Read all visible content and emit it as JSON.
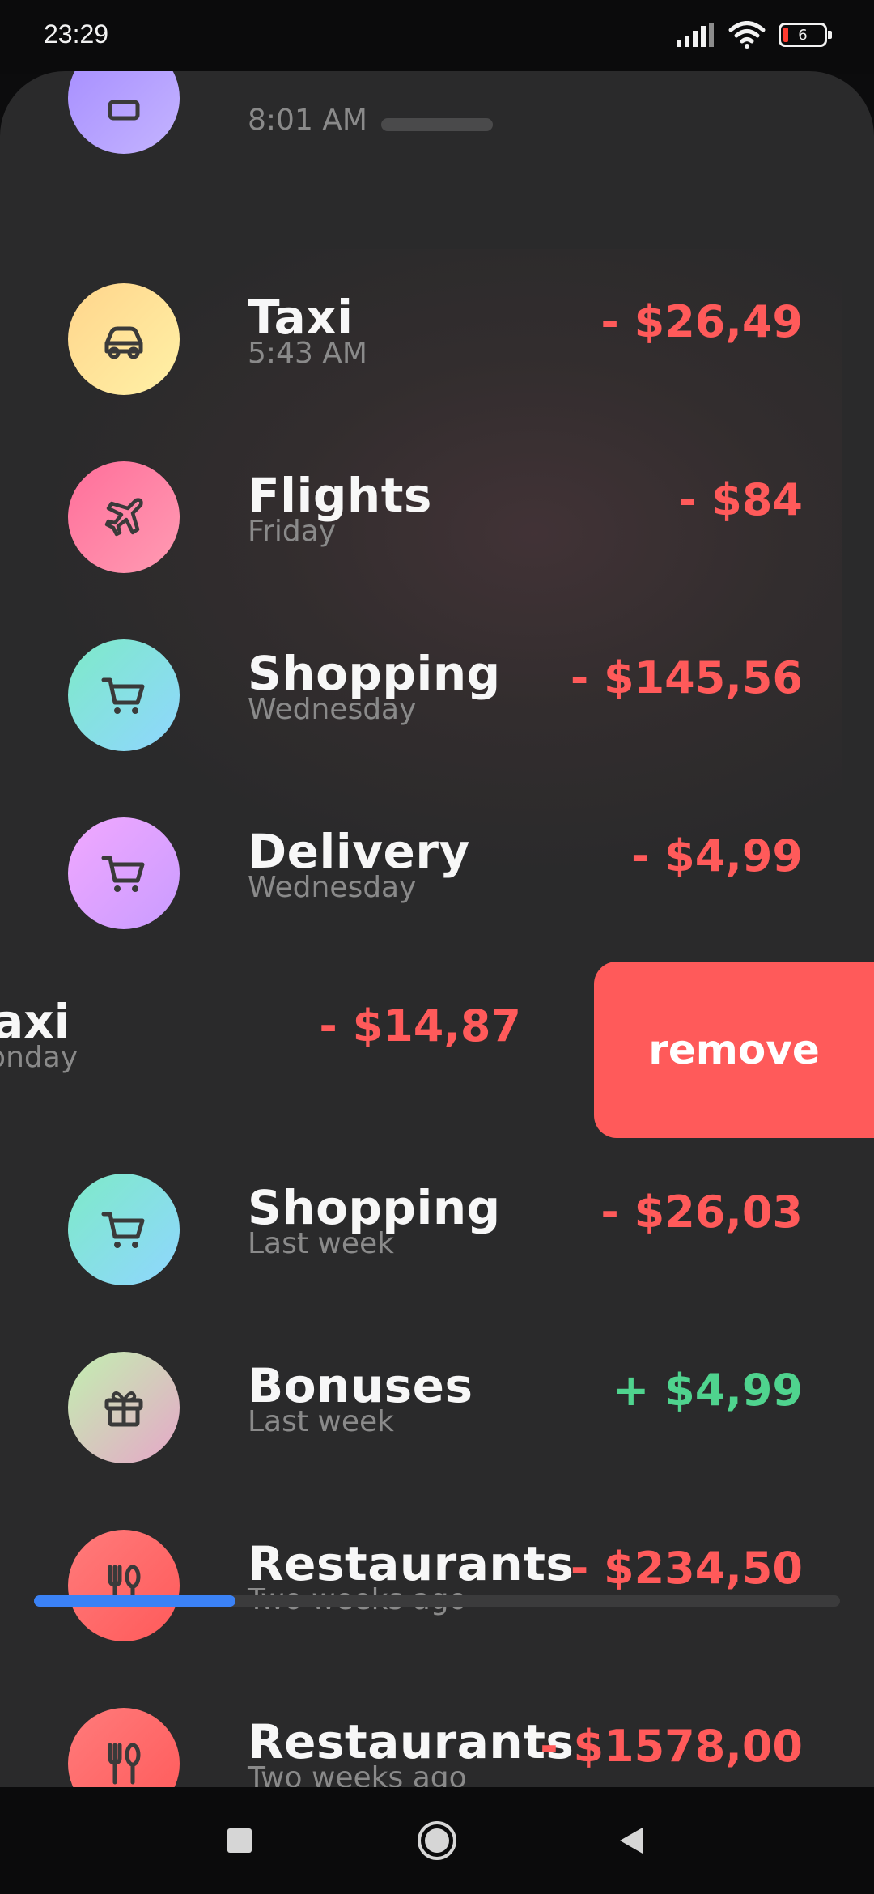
{
  "status_bar": {
    "time": "23:29",
    "battery": "6"
  },
  "transactions": [
    {
      "title": "",
      "subtitle": "8:01 AM",
      "amount": "",
      "icon": "generic-icon",
      "gradient": [
        "#a58cff",
        "#c4b4ff"
      ]
    },
    {
      "title": "Taxi",
      "subtitle": "5:43 AM",
      "amount": "- $26,49",
      "icon": "car-icon",
      "gradient": [
        "#ffd58c",
        "#fff1a6"
      ]
    },
    {
      "title": "Flights",
      "subtitle": "Friday",
      "amount": "- $84",
      "icon": "plane-icon",
      "gradient": [
        "#ff6f9a",
        "#ff9bb3"
      ]
    },
    {
      "title": "Shopping",
      "subtitle": "Wednesday",
      "amount": "- $145,56",
      "icon": "cart-icon",
      "gradient": [
        "#7eeac8",
        "#8fd6ff"
      ]
    },
    {
      "title": "Delivery",
      "subtitle": "Wednesday",
      "amount": "- $4,99",
      "icon": "cart-icon",
      "gradient": [
        "#f1a8ff",
        "#c99cff"
      ]
    },
    {
      "title": "Shopping",
      "subtitle": "Last week",
      "amount": "- $26,03",
      "icon": "cart-icon",
      "gradient": [
        "#7eeac8",
        "#8fd6ff"
      ]
    },
    {
      "title": "Bonuses",
      "subtitle": "Last week",
      "amount": "+ $4,99",
      "icon": "gift-icon",
      "gradient": [
        "#c2f0b0",
        "#e6a7c8"
      ]
    },
    {
      "title": "Restaurants",
      "subtitle": "Two weeks ago",
      "amount": "- $234,50",
      "icon": "restaurant-icon",
      "gradient": [
        "#ff7b7b",
        "#ff5a5a"
      ]
    },
    {
      "title": "Restaurants",
      "subtitle": "Two weeks ago",
      "amount": "- $1578,00",
      "icon": "restaurant-icon",
      "gradient": [
        "#ff7b7b",
        "#ff5a5a"
      ]
    }
  ],
  "swiped_row": {
    "title": "Taxi",
    "subtitle": "Monday",
    "amount": "- $14,87",
    "remove_label": "remove"
  },
  "scroll_progress": 0.25,
  "colors": {
    "expense": "#ff5a5a",
    "income": "#4fd38e",
    "accent": "#3b82f6"
  }
}
